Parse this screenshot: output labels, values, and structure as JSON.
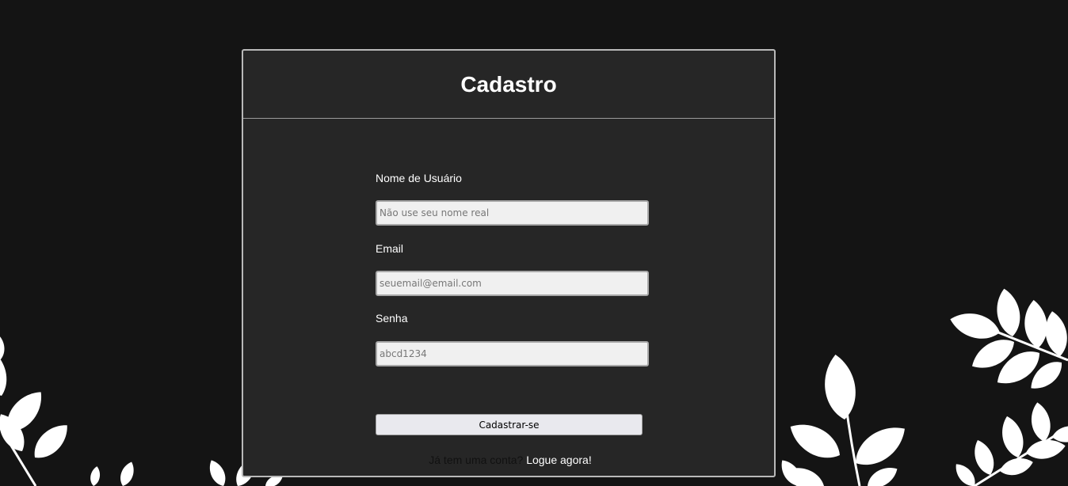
{
  "card": {
    "title": "Cadastro"
  },
  "form": {
    "username": {
      "label": "Nome de Usuário",
      "placeholder": "Não use seu nome real",
      "value": ""
    },
    "email": {
      "label": "Email",
      "placeholder": "seuemail@email.com",
      "value": ""
    },
    "password": {
      "label": "Senha",
      "placeholder": "abcd1234",
      "value": ""
    },
    "submit_label": "Cadastrar-se"
  },
  "footer": {
    "question": "Já tem uma conta?",
    "link_label": "Logue agora!"
  },
  "colors": {
    "background": "#141414",
    "card": "#262626",
    "card_border": "#b9b9b9",
    "leaf": "#ffffff"
  }
}
